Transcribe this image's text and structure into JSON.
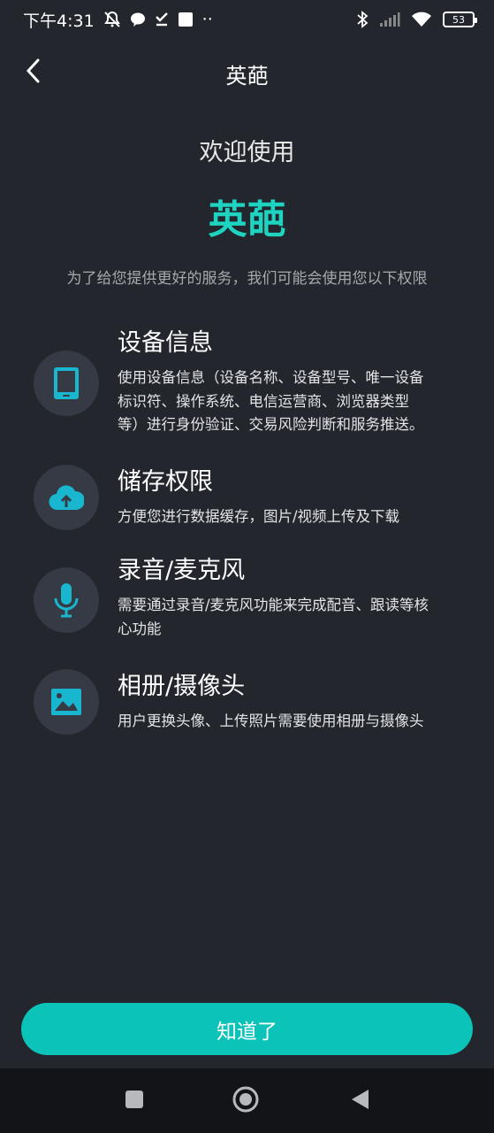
{
  "status_bar": {
    "time": "下午4:31",
    "dots": "··",
    "battery": "53",
    "icons": [
      "mute-bell-icon",
      "chat-icon",
      "check-icon",
      "square-icon",
      "bluetooth-icon",
      "signal-icon",
      "wifi-icon",
      "battery-icon"
    ]
  },
  "nav": {
    "title": "英葩",
    "back_icon": "chevron-left-icon"
  },
  "welcome": {
    "greeting": "欢迎使用",
    "app_name": "英葩",
    "intro": "为了给您提供更好的服务，我们可能会使用您以下权限"
  },
  "permissions": [
    {
      "icon": "tablet-icon",
      "title": "设备信息",
      "desc_lines": [
        "使用设备信息（设备名称、设备型号、唯一设备",
        "标识符、操作系统、电信运营商、浏览器类型",
        "等）进行身份验证、交易风险判断和服务推送。"
      ]
    },
    {
      "icon": "cloud-upload-icon",
      "title": "储存权限",
      "desc_lines": [
        "方便您进行数据缓存，图片/视频上传及下载"
      ]
    },
    {
      "icon": "microphone-icon",
      "title": "录音/麦克风",
      "desc_lines": [
        "需要通过录音/麦克风功能来完成配音、跟读等核",
        "心功能"
      ]
    },
    {
      "icon": "image-icon",
      "title": "相册/摄像头",
      "desc_lines": [
        "用户更换头像、上传照片需要使用相册与摄像头"
      ]
    }
  ],
  "confirm": {
    "label": "知道了"
  },
  "colors": {
    "background": "#23262d",
    "accent": "#1ed3c0",
    "button": "#0bc3b8",
    "icon": "#19b7cf",
    "icon_circle": "#363a44"
  }
}
